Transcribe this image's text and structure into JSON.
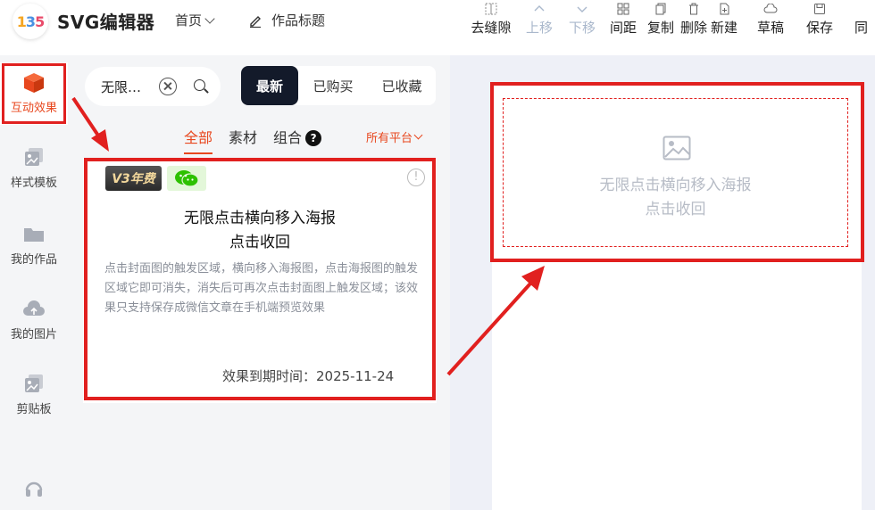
{
  "header": {
    "logo_text": "135",
    "app_name": "SVG编辑器",
    "home_menu": "首页",
    "work_title": "作品标题"
  },
  "toolbar": [
    {
      "label": "去缝隙",
      "icon": "grid-icon",
      "enabled": true
    },
    {
      "label": "上移",
      "icon": "arrow-up-icon",
      "enabled": false
    },
    {
      "label": "下移",
      "icon": "arrow-down-icon",
      "enabled": false
    },
    {
      "label": "间距",
      "icon": "spacing-icon",
      "enabled": true
    },
    {
      "label": "复制",
      "icon": "copy-icon",
      "enabled": true
    },
    {
      "label": "删除",
      "icon": "trash-icon",
      "enabled": true
    },
    {
      "label": "新建",
      "icon": "new-file-icon",
      "enabled": true
    },
    {
      "label": "草稿",
      "icon": "cloud-icon",
      "enabled": true
    },
    {
      "label": "保存",
      "icon": "save-icon",
      "enabled": true
    },
    {
      "label": "同",
      "icon": "sync-icon",
      "enabled": true
    }
  ],
  "rail": [
    {
      "label": "互动效果",
      "icon": "cube-icon",
      "active": true
    },
    {
      "label": "样式模板",
      "icon": "template-icon",
      "active": false
    },
    {
      "label": "我的作品",
      "icon": "folder-icon",
      "active": false
    },
    {
      "label": "我的图片",
      "icon": "cloud-upload-icon",
      "active": false
    },
    {
      "label": "剪贴板",
      "icon": "clipboard-icon",
      "active": false
    },
    {
      "label": "",
      "icon": "headset-icon",
      "active": false
    }
  ],
  "search": {
    "value": "无限…"
  },
  "segment": {
    "options": [
      "最新",
      "已购买",
      "已收藏"
    ],
    "selected": "最新"
  },
  "subtabs": {
    "items": [
      "全部",
      "素材",
      "组合"
    ],
    "selected": "全部",
    "help": "?"
  },
  "platform_filter": "所有平台",
  "card": {
    "badge_v3": "V3年费",
    "title_line1": "无限点击横向移入海报",
    "title_line2": "点击收回",
    "description": "点击封面图的触发区域，横向移入海报图，点击海报图的触发区域它即可消失，消失后可再次点击封面图上触发区域；该效果只支持保存成微信文章在手机端预览效果",
    "expiry": "效果到期时间：2025-11-24",
    "info": "!"
  },
  "poster": {
    "line1": "无限点击横向移入海报",
    "line2": "点击收回"
  },
  "colors": {
    "accent": "#e8471e",
    "highlight": "#e1201f",
    "dark_segment": "#131a2a"
  }
}
